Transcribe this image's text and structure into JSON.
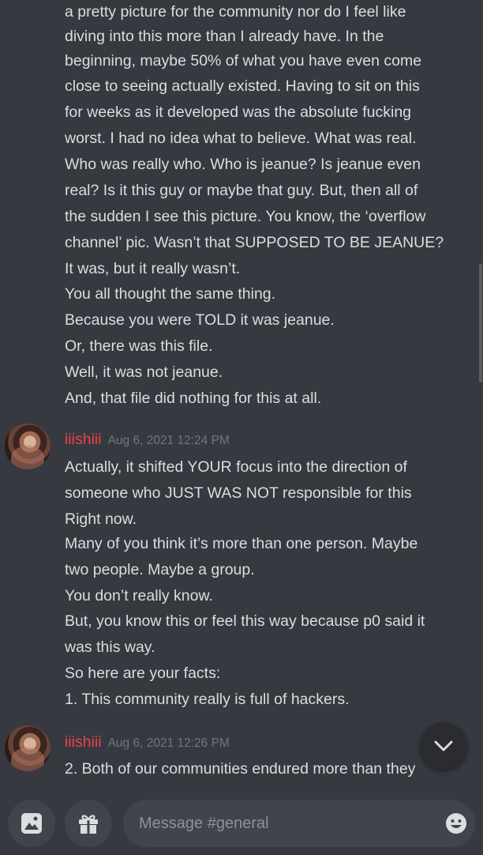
{
  "channel": {
    "name": "#general"
  },
  "messages": [
    {
      "continuation": true,
      "lines": [
        "a pretty picture for the community nor do I feel like",
        "diving into this more than I already have. In the",
        "beginning, maybe 50% of what you have even come",
        "close to seeing actually existed. Having to sit on this",
        "for weeks as it developed was the absolute fucking",
        "worst. I had no idea what to believe. What was real.",
        "Who was really who. Who is jeanue? Is jeanue even",
        "real? Is it this guy or maybe that guy. But, then all of",
        "the sudden I see this picture. You know, the ‘overflow",
        "channel’ pic. Wasn’t that SUPPOSED TO BE JEANUE?",
        "It was, but it really wasn’t.",
        "You all thought the same thing.",
        "Because you were TOLD it was jeanue.",
        "Or, there was this file.",
        "Well, it was not jeanue.",
        "And, that file did nothing for this at all."
      ]
    },
    {
      "author": "iiishiii",
      "timestamp": "Aug 6, 2021 12:24 PM",
      "lines": [
        "Actually, it shifted YOUR focus into the direction of",
        "someone who JUST WAS NOT responsible for this",
        "Right now.",
        "Many of you think it’s more than one person. Maybe",
        "two people. Maybe a group.",
        "You don’t really know.",
        "But, you know this or feel this way because p0 said it",
        "was this way.",
        "So here are your facts:",
        "1. This community really is full of hackers."
      ]
    },
    {
      "author": "iiishiii",
      "timestamp": "Aug 6, 2021 12:26 PM",
      "lines": [
        "2. Both of our communities endured more than they"
      ]
    }
  ],
  "composer": {
    "placeholder": "Message #general",
    "value": ""
  },
  "icons": {
    "attach": "image-icon",
    "gift": "gift-icon",
    "emoji": "emoji-icon",
    "scroll_down": "chevron-down-icon"
  },
  "colors": {
    "background": "#36393f",
    "text": "#dcddde",
    "username": "#ed4245",
    "timestamp": "#72767d",
    "input_bg": "#40444b"
  }
}
